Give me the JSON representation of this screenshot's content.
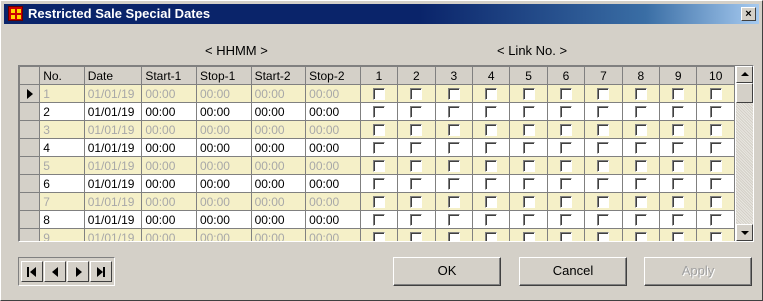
{
  "window": {
    "title": "Restricted Sale Special Dates",
    "close_glyph": "×"
  },
  "headers": {
    "hhmm": "< HHMM >",
    "link_no": "< Link No. >"
  },
  "grid": {
    "columns": [
      "No.",
      "Date",
      "Start-1",
      "Stop-1",
      "Start-2",
      "Stop-2",
      "1",
      "2",
      "3",
      "4",
      "5",
      "6",
      "7",
      "8",
      "9",
      "10"
    ],
    "rows": [
      {
        "no": "1",
        "date": "01/01/19",
        "start1": "00:00",
        "stop1": "00:00",
        "start2": "00:00",
        "stop2": "00:00"
      },
      {
        "no": "2",
        "date": "01/01/19",
        "start1": "00:00",
        "stop1": "00:00",
        "start2": "00:00",
        "stop2": "00:00"
      },
      {
        "no": "3",
        "date": "01/01/19",
        "start1": "00:00",
        "stop1": "00:00",
        "start2": "00:00",
        "stop2": "00:00"
      },
      {
        "no": "4",
        "date": "01/01/19",
        "start1": "00:00",
        "stop1": "00:00",
        "start2": "00:00",
        "stop2": "00:00"
      },
      {
        "no": "5",
        "date": "01/01/19",
        "start1": "00:00",
        "stop1": "00:00",
        "start2": "00:00",
        "stop2": "00:00"
      },
      {
        "no": "6",
        "date": "01/01/19",
        "start1": "00:00",
        "stop1": "00:00",
        "start2": "00:00",
        "stop2": "00:00"
      },
      {
        "no": "7",
        "date": "01/01/19",
        "start1": "00:00",
        "stop1": "00:00",
        "start2": "00:00",
        "stop2": "00:00"
      },
      {
        "no": "8",
        "date": "01/01/19",
        "start1": "00:00",
        "stop1": "00:00",
        "start2": "00:00",
        "stop2": "00:00"
      },
      {
        "no": "9",
        "date": "01/01/19",
        "start1": "00:00",
        "stop1": "00:00",
        "start2": "00:00",
        "stop2": "00:00"
      }
    ],
    "current_row": "1"
  },
  "buttons": {
    "ok": "OK",
    "cancel": "Cancel",
    "apply": "Apply"
  },
  "icons": {
    "app": "app-grid-icon",
    "close": "close-icon",
    "first": "first-record-icon",
    "prev": "prev-record-icon",
    "next": "next-record-icon",
    "last": "last-record-icon",
    "scroll_up": "scroll-up-icon",
    "scroll_down": "scroll-down-icon",
    "current_row": "current-row-pointer-icon"
  },
  "colors": {
    "title_bar": "#0a246a",
    "face": "#d4d0c8",
    "alt_row": "#f5f0c8",
    "disabled_text": "#a8a8a8"
  }
}
